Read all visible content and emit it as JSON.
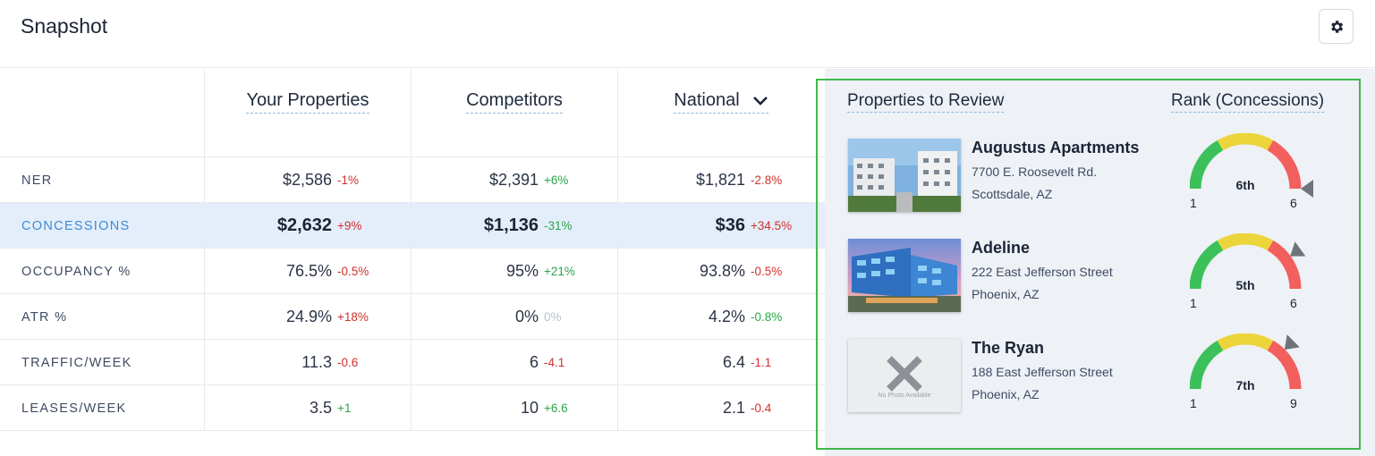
{
  "header": {
    "title": "Snapshot",
    "settings_icon": "gear-icon"
  },
  "columns": [
    {
      "label": "Your Properties",
      "dropdown": false
    },
    {
      "label": "Competitors",
      "dropdown": false
    },
    {
      "label": "National",
      "dropdown": true
    }
  ],
  "rows": [
    {
      "label": "NER",
      "highlight": false,
      "cells": [
        {
          "value": "$2,586",
          "change": "-1%",
          "trend": "neg"
        },
        {
          "value": "$2,391",
          "change": "+6%",
          "trend": "pos"
        },
        {
          "value": "$1,821",
          "change": "-2.8%",
          "trend": "neg"
        }
      ]
    },
    {
      "label": "CONCESSIONS",
      "highlight": true,
      "cells": [
        {
          "value": "$2,632",
          "change": "+9%",
          "trend": "neg"
        },
        {
          "value": "$1,136",
          "change": "-31%",
          "trend": "pos"
        },
        {
          "value": "$36",
          "change": "+34.5%",
          "trend": "neg"
        }
      ]
    },
    {
      "label": "OCCUPANCY %",
      "highlight": false,
      "cells": [
        {
          "value": "76.5%",
          "change": "-0.5%",
          "trend": "neg"
        },
        {
          "value": "95%",
          "change": "+21%",
          "trend": "pos"
        },
        {
          "value": "93.8%",
          "change": "-0.5%",
          "trend": "neg"
        }
      ]
    },
    {
      "label": "ATR %",
      "highlight": false,
      "cells": [
        {
          "value": "24.9%",
          "change": "+18%",
          "trend": "neg"
        },
        {
          "value": "0%",
          "change": "0%",
          "trend": "zero"
        },
        {
          "value": "4.2%",
          "change": "-0.8%",
          "trend": "pos"
        }
      ]
    },
    {
      "label": "TRAFFIC/WEEK",
      "highlight": false,
      "cells": [
        {
          "value": "11.3",
          "change": "-0.6",
          "trend": "neg"
        },
        {
          "value": "6",
          "change": "-4.1",
          "trend": "neg"
        },
        {
          "value": "6.4",
          "change": "-1.1",
          "trend": "neg"
        }
      ]
    },
    {
      "label": "LEASES/WEEK",
      "highlight": false,
      "cells": [
        {
          "value": "3.5",
          "change": "+1",
          "trend": "pos"
        },
        {
          "value": "10",
          "change": "+6.6",
          "trend": "pos"
        },
        {
          "value": "2.1",
          "change": "-0.4",
          "trend": "neg"
        }
      ]
    }
  ],
  "review": {
    "title": "Properties to Review",
    "rank_title": "Rank (Concessions)",
    "properties": [
      {
        "name": "Augustus Apartments",
        "address": "7700 E. Roosevelt Rd.",
        "city": "Scottsdale, AZ",
        "photo": "apartment-photo",
        "rank_label": "6th",
        "rank": 6,
        "min": "1",
        "max": "6",
        "max_value": 6
      },
      {
        "name": "Adeline",
        "address": "222 East Jefferson Street",
        "city": "Phoenix, AZ",
        "photo": "apartment-photo",
        "rank_label": "5th",
        "rank": 5,
        "min": "1",
        "max": "6",
        "max_value": 6
      },
      {
        "name": "The Ryan",
        "address": "188 East Jefferson Street",
        "city": "Phoenix, AZ",
        "photo": "no-photo",
        "no_photo_text": "No Photo Available",
        "rank_label": "7th",
        "rank": 7,
        "min": "1",
        "max": "9",
        "max_value": 9
      }
    ]
  },
  "colors": {
    "positive": "#28a745",
    "negative": "#d0312d",
    "gauge_green": "#3cc15a",
    "gauge_yellow": "#ecd53a",
    "gauge_red": "#f25f5c",
    "panel_border": "#3fb94a"
  }
}
